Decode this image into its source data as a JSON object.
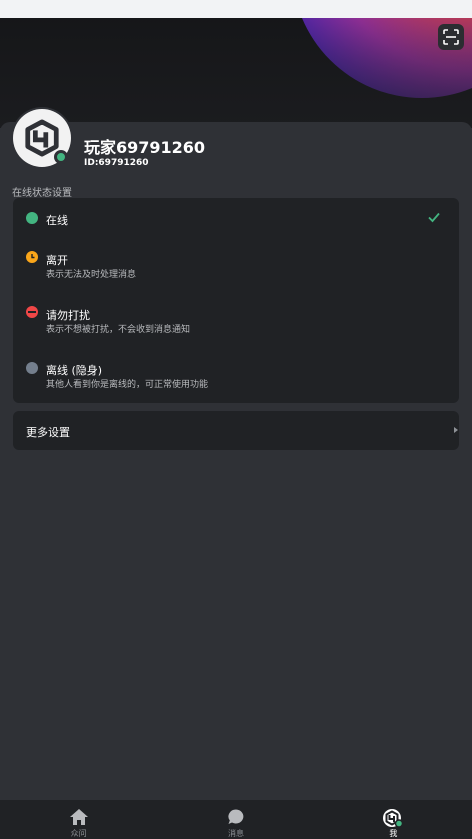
{
  "profile": {
    "name": "玩家69791260",
    "id_label": "ID:69791260"
  },
  "status_section": {
    "title": "在线状态设置",
    "options": [
      {
        "key": "online",
        "title": "在线",
        "desc": "",
        "color": "#43b581",
        "selected": true
      },
      {
        "key": "away",
        "title": "离开",
        "desc": "表示无法及时处理消息",
        "color": "#faa61a",
        "selected": false
      },
      {
        "key": "dnd",
        "title": "请勿打扰",
        "desc": "表示不想被打扰，不会收到消息通知",
        "color": "#f04747",
        "selected": false
      },
      {
        "key": "invisible",
        "title": "离线 (隐身)",
        "desc": "其他人看到你是离线的，可正常使用功能",
        "color": "#747f8d",
        "selected": false
      }
    ]
  },
  "more_settings": {
    "label": "更多设置"
  },
  "tabs": [
    {
      "label": "众问",
      "icon": "home-icon",
      "active": false
    },
    {
      "label": "消息",
      "icon": "chat-icon",
      "active": false
    },
    {
      "label": "我",
      "icon": "profile-icon",
      "active": true
    }
  ],
  "colors": {
    "accent_green": "#43b581",
    "away": "#faa61a",
    "dnd": "#f04747",
    "offline": "#747f8d",
    "background": "#2f3136",
    "card": "#202225"
  }
}
